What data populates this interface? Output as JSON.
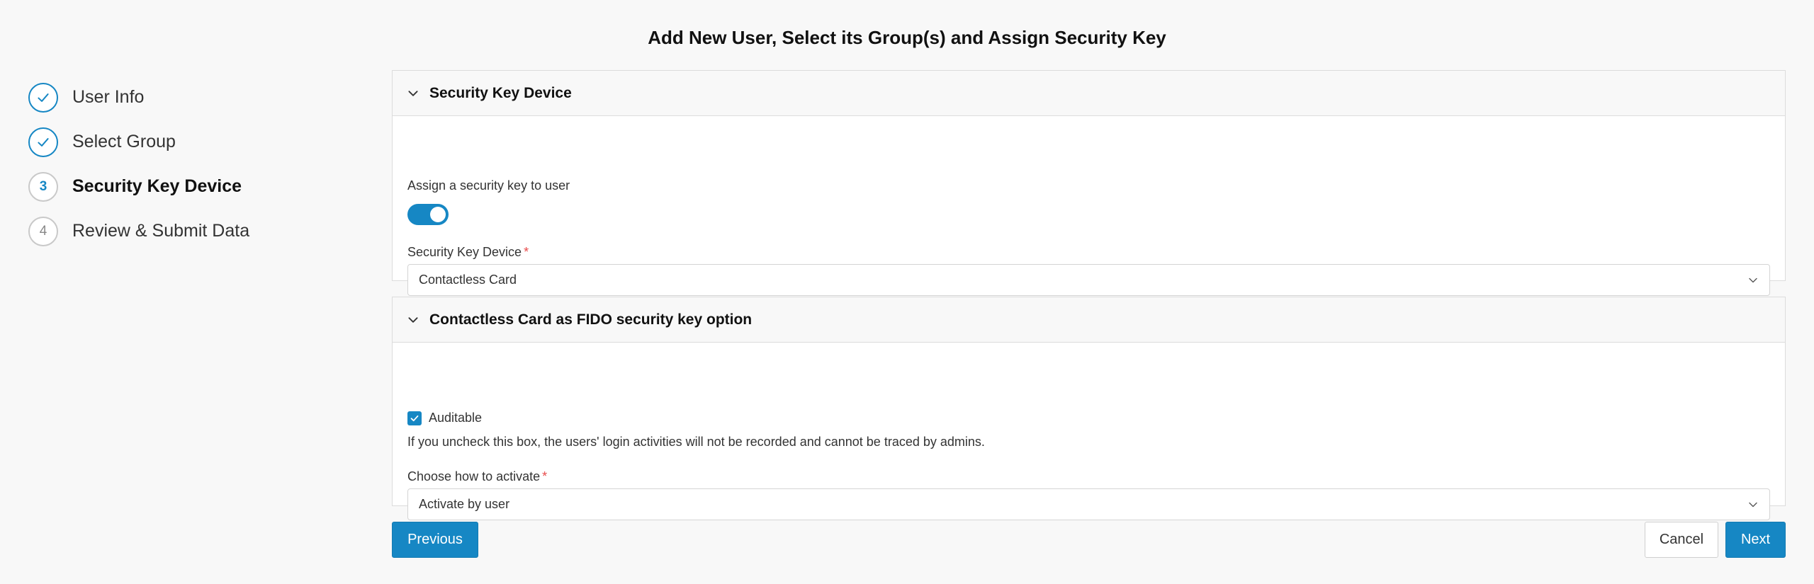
{
  "page": {
    "title": "Add New User, Select its Group(s) and Assign Security Key"
  },
  "steps": [
    {
      "label": "User Info",
      "status": "done",
      "marker": ""
    },
    {
      "label": "Select Group",
      "status": "done",
      "marker": ""
    },
    {
      "label": "Security Key Device",
      "status": "current",
      "marker": "3"
    },
    {
      "label": "Review & Submit Data",
      "status": "todo",
      "marker": "4"
    }
  ],
  "panel_security": {
    "title": "Security Key Device",
    "assign_label": "Assign a security key to user",
    "assign_enabled": true,
    "device_label": "Security Key Device",
    "device_required_mark": "*",
    "device_value": "Contactless Card"
  },
  "panel_fido": {
    "title": "Contactless Card as FIDO security key option",
    "auditable_label": "Auditable",
    "auditable_checked": true,
    "auditable_help": "If you uncheck this box, the users' login activities will not be recorded and cannot be traced by admins.",
    "activate_label": "Choose how to activate",
    "activate_required_mark": "*",
    "activate_value": "Activate by user"
  },
  "buttons": {
    "previous": "Previous",
    "cancel": "Cancel",
    "next": "Next"
  },
  "colors": {
    "accent": "#1687c4",
    "required": "#e84b4b",
    "border": "#dcdcdc"
  }
}
